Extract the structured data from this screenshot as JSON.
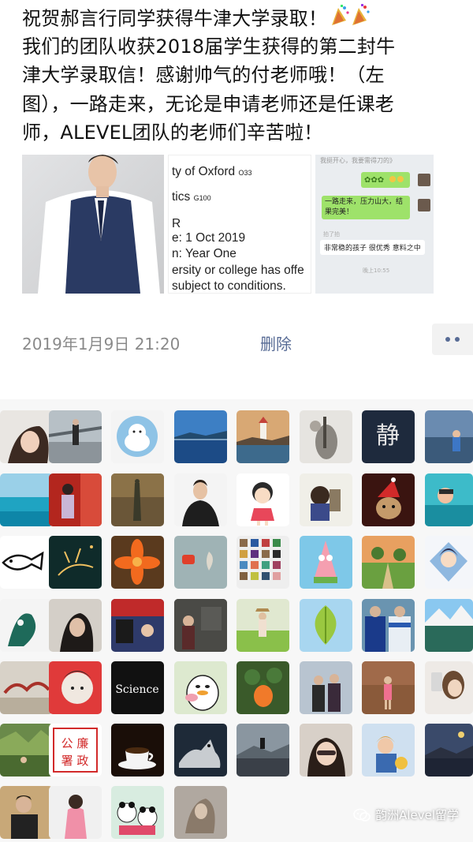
{
  "post": {
    "lines": [
      "祝贺郝言行同学获得牛津大学录取！",
      "我们的团队收获2018届学生获得的第二封牛",
      "津大学录取信！感谢帅气的付老师哦！（左",
      "图），一路走来，无论是申请老师还是任课老",
      "师，ALEVEL团队的老师们辛苦啦！"
    ],
    "emoji": "party-popper-icon"
  },
  "letter": {
    "line1": "ty of Oxford",
    "line1_code": "O33",
    "line2": "tics",
    "line2_code": "G100",
    "line3": "R",
    "line4": "e: 1 Oct 2019",
    "line5": "n: Year One",
    "line6": "ersity or college has offe",
    "line7": "subject to conditions."
  },
  "chat": {
    "top_text": "我挺开心，我要需得刀的》",
    "bubble1": "一路走来，压力山大，结果完美！",
    "sys1": "拍了拍",
    "bubble2": "非常稳的孩子 很优秀 意料之中",
    "sys2": "晚上10:55"
  },
  "meta": {
    "timestamp": "2019年1月9日 21:20",
    "delete_label": "删除"
  },
  "likes": {
    "avatar_labels": {
      "static_logo": "静",
      "science_label": "Science",
      "seal_text": "公 署 廉 政"
    }
  },
  "watermark": {
    "text": "韵洲Alevel留学"
  },
  "colors": {
    "link": "#576b95",
    "meta_gray": "#8a8a8a",
    "likes_bg": "#f7f7f7",
    "text": "#111111"
  }
}
